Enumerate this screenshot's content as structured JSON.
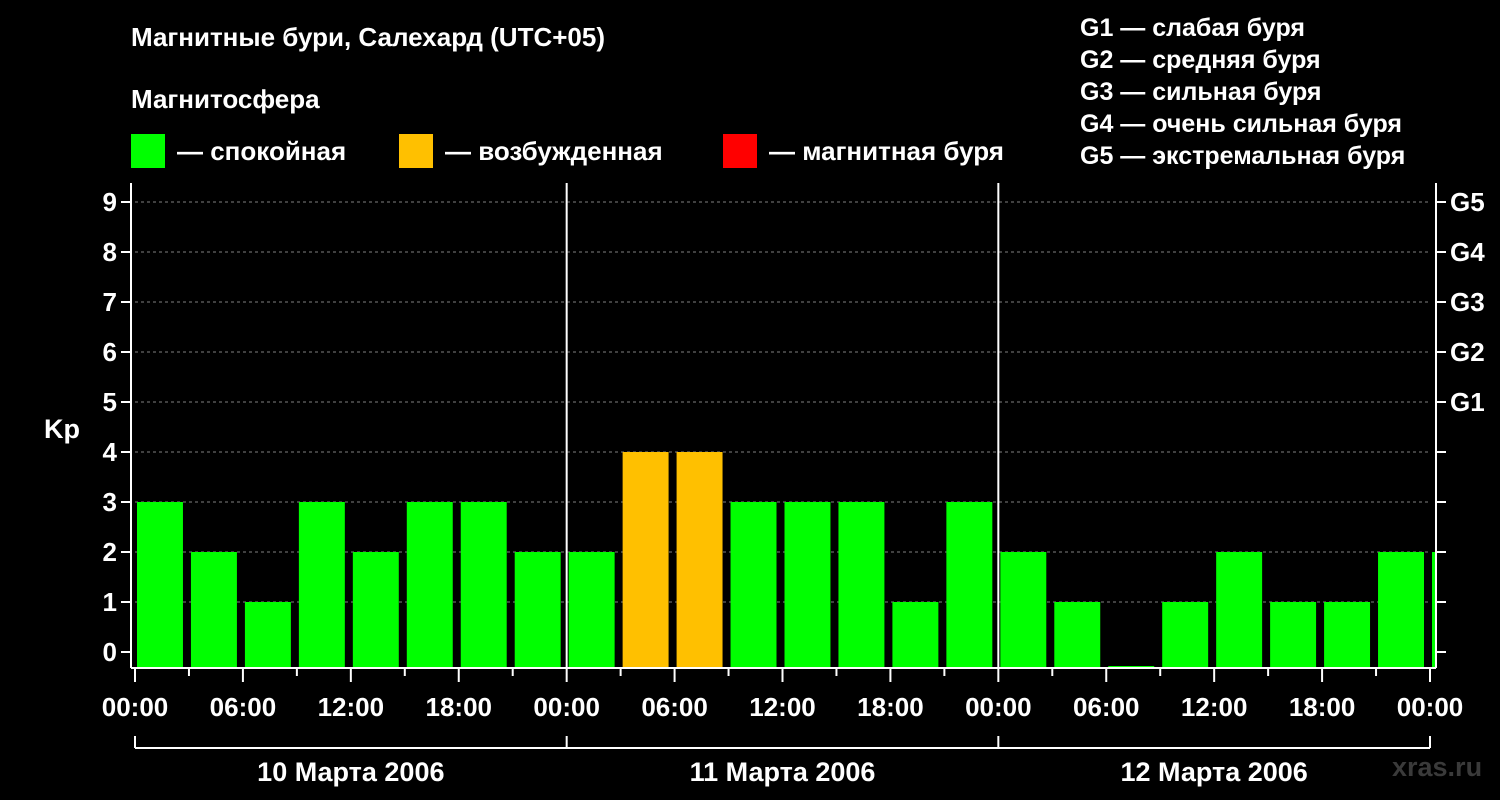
{
  "title": "Магнитные бури, Салехард (UTC+05)",
  "subtitle": "Магнитосфера",
  "legend": [
    {
      "label": "— спокойная",
      "color": "#00ff00"
    },
    {
      "label": "— возбужденная",
      "color": "#ffc000"
    },
    {
      "label": "— магнитная буря",
      "color": "#ff0000"
    }
  ],
  "g_legend": [
    "G1 — слабая буря",
    "G2 — средняя буря",
    "G3 — сильная буря",
    "G4 — очень сильная буря",
    "G5 — экстремальная буря"
  ],
  "watermark": "xras.ru",
  "colors": {
    "quiet": "#00ff00",
    "active": "#ffc000",
    "storm": "#ff0000",
    "background": "#000000"
  },
  "chart_data": {
    "type": "bar",
    "ylabel": "Kp",
    "ylim": [
      0,
      9
    ],
    "yticks": [
      "0",
      "1",
      "2",
      "3",
      "4",
      "5",
      "6",
      "7",
      "8",
      "9"
    ],
    "right_axis_labels": [
      {
        "kp": 5,
        "label": "G1"
      },
      {
        "kp": 6,
        "label": "G2"
      },
      {
        "kp": 7,
        "label": "G3"
      },
      {
        "kp": 8,
        "label": "G4"
      },
      {
        "kp": 9,
        "label": "G5"
      }
    ],
    "xtick_labels": [
      "00:00",
      "06:00",
      "12:00",
      "18:00",
      "00:00",
      "06:00",
      "12:00",
      "18:00",
      "00:00",
      "06:00",
      "12:00",
      "18:00",
      "00:00"
    ],
    "days": [
      "10 Марта 2006",
      "11 Марта 2006",
      "12 Марта 2006"
    ],
    "grid": true,
    "values": [
      3,
      2,
      1,
      3,
      2,
      3,
      3,
      2,
      2,
      4,
      4,
      3,
      3,
      3,
      1,
      3,
      2,
      1,
      0,
      1,
      2,
      1,
      1,
      2,
      2
    ],
    "levels": [
      "quiet",
      "quiet",
      "quiet",
      "quiet",
      "quiet",
      "quiet",
      "quiet",
      "quiet",
      "quiet",
      "active",
      "active",
      "quiet",
      "quiet",
      "quiet",
      "quiet",
      "quiet",
      "quiet",
      "quiet",
      "quiet",
      "quiet",
      "quiet",
      "quiet",
      "quiet",
      "quiet",
      "quiet"
    ]
  }
}
